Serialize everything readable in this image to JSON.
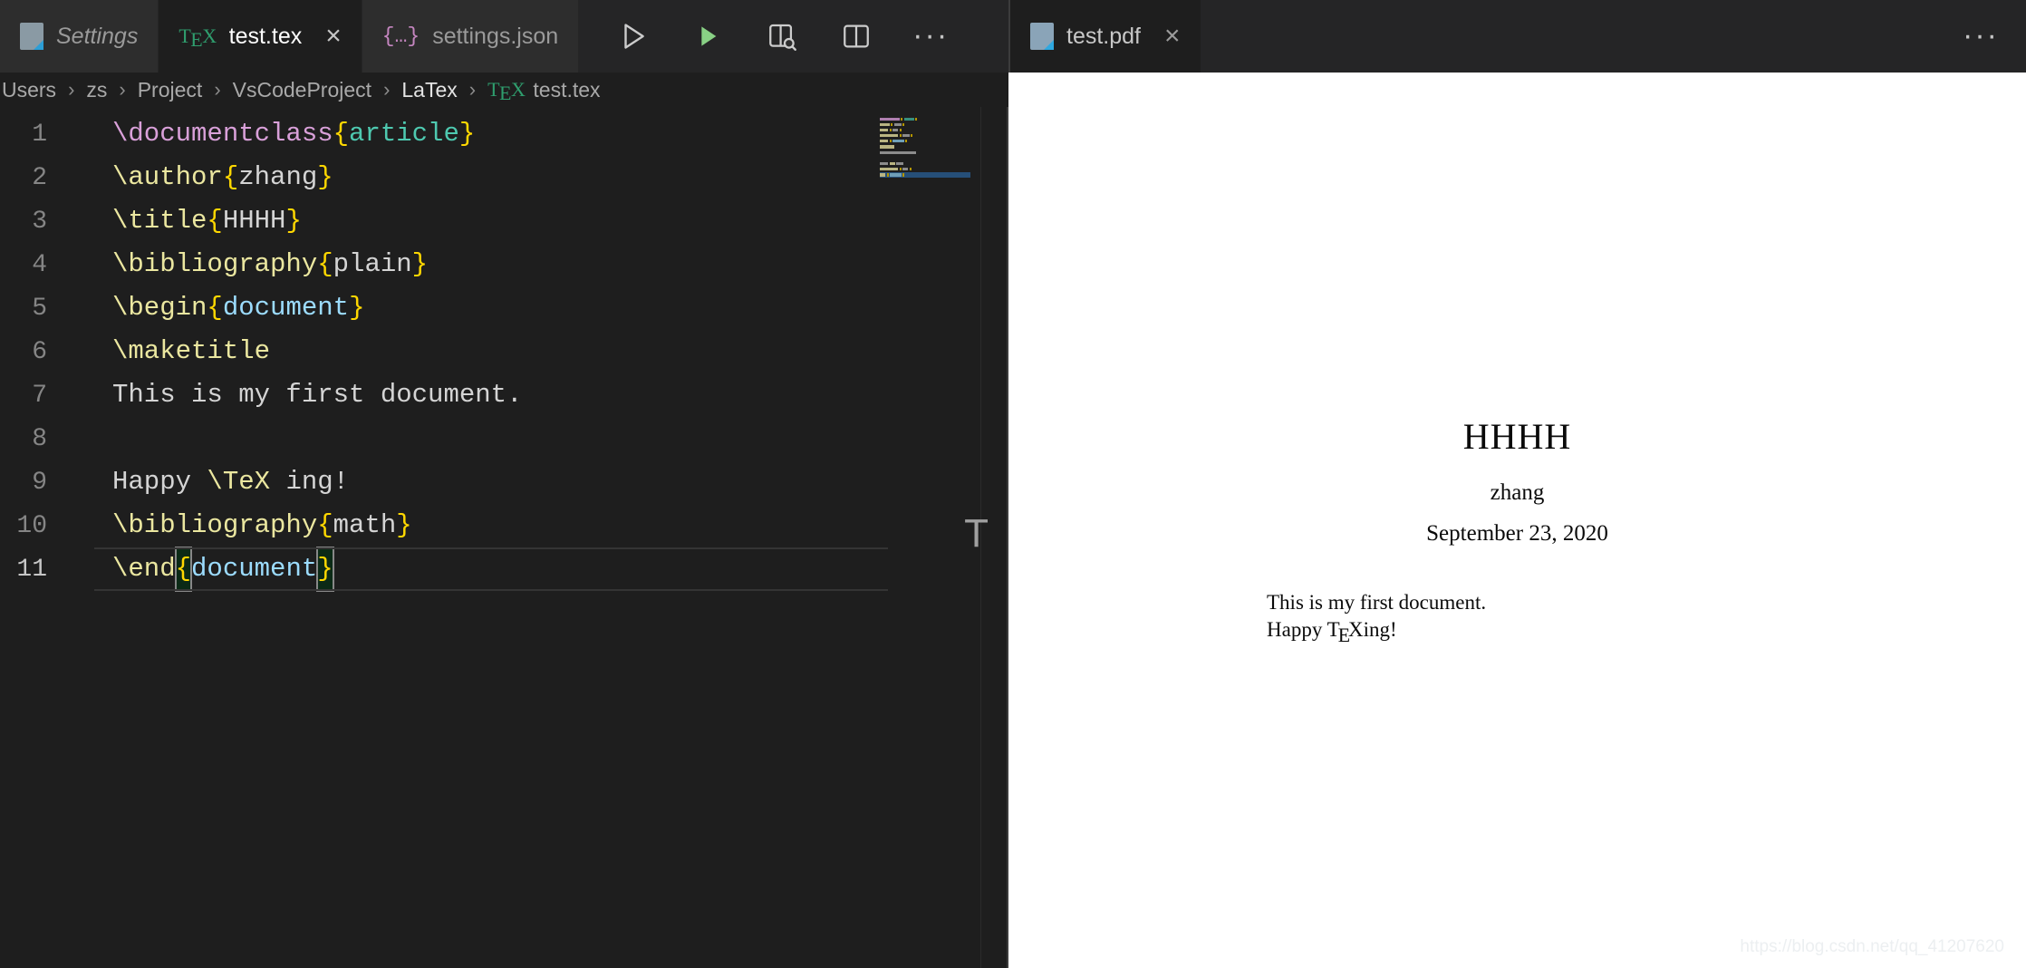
{
  "window": {
    "app": "Visual Studio Code",
    "theme_bg": "#1e1e1e",
    "tabbar_bg": "#252526",
    "accent_green": "#89d185"
  },
  "left_editor_group": {
    "tabs": [
      {
        "label": "Settings",
        "icon": "settings-document-icon",
        "active": false,
        "italic": true,
        "closable": false
      },
      {
        "label": "test.tex",
        "icon": "tex-file-icon",
        "active": true,
        "italic": false,
        "closable": true,
        "close_label": "×"
      },
      {
        "label": "settings.json",
        "icon": "json-file-icon",
        "active": false,
        "italic": false,
        "closable": false
      }
    ],
    "actions": [
      {
        "name": "build-latex-project-button",
        "icon": "play-outline-icon",
        "label": "Build LaTeX project"
      },
      {
        "name": "run-button",
        "icon": "play-filled-green-icon",
        "label": "Run"
      },
      {
        "name": "view-latex-pdf-button",
        "icon": "split-preview-search-icon",
        "label": "View LaTeX PDF file"
      },
      {
        "name": "split-editor-button",
        "icon": "split-editor-icon",
        "label": "Split Editor"
      },
      {
        "name": "more-actions-button",
        "icon": "ellipsis-icon",
        "label": "···"
      }
    ],
    "breadcrumb": {
      "separator": "›",
      "items": [
        {
          "label": "Users",
          "strong": false
        },
        {
          "label": "zs",
          "strong": false
        },
        {
          "label": "Project",
          "strong": false
        },
        {
          "label": "VsCodeProject",
          "strong": false
        },
        {
          "label": "LaTex",
          "strong": true
        },
        {
          "label": "test.tex",
          "strong": false,
          "icon": "tex-file-icon"
        }
      ]
    }
  },
  "right_editor_group": {
    "tabs": [
      {
        "label": "test.pdf",
        "icon": "pdf-document-icon",
        "active": true,
        "closable": true,
        "close_label": "×"
      }
    ],
    "actions": [
      {
        "name": "more-actions-button",
        "icon": "ellipsis-icon",
        "label": "···"
      }
    ]
  },
  "code": {
    "language": "latex",
    "active_line": 11,
    "lines": [
      {
        "n": "1",
        "tokens": [
          {
            "t": "\\documentclass",
            "c": "tok-cmd2"
          },
          {
            "t": "{",
            "c": "tok-brace"
          },
          {
            "t": "article",
            "c": "tok-green"
          },
          {
            "t": "}",
            "c": "tok-brace"
          }
        ]
      },
      {
        "n": "2",
        "tokens": [
          {
            "t": "\\author",
            "c": "tok-cmd"
          },
          {
            "t": "{",
            "c": "tok-brace"
          },
          {
            "t": "zhang",
            "c": "tok-arg"
          },
          {
            "t": "}",
            "c": "tok-brace"
          }
        ]
      },
      {
        "n": "3",
        "tokens": [
          {
            "t": "\\title",
            "c": "tok-cmd"
          },
          {
            "t": "{",
            "c": "tok-brace"
          },
          {
            "t": "HHHH",
            "c": "tok-arg"
          },
          {
            "t": "}",
            "c": "tok-brace"
          }
        ]
      },
      {
        "n": "4",
        "tokens": [
          {
            "t": "\\bibliography",
            "c": "tok-cmd"
          },
          {
            "t": "{",
            "c": "tok-brace"
          },
          {
            "t": "plain",
            "c": "tok-arg"
          },
          {
            "t": "}",
            "c": "tok-brace"
          }
        ]
      },
      {
        "n": "5",
        "tokens": [
          {
            "t": "\\begin",
            "c": "tok-cmd"
          },
          {
            "t": "{",
            "c": "tok-brace"
          },
          {
            "t": "document",
            "c": "tok-blue"
          },
          {
            "t": "}",
            "c": "tok-brace"
          }
        ]
      },
      {
        "n": "6",
        "tokens": [
          {
            "t": "\\maketitle",
            "c": "tok-cmd"
          }
        ]
      },
      {
        "n": "7",
        "tokens": [
          {
            "t": "This is my first document.",
            "c": "tok-plain"
          }
        ]
      },
      {
        "n": "8",
        "tokens": []
      },
      {
        "n": "9",
        "tokens": [
          {
            "t": "Happy ",
            "c": "tok-plain"
          },
          {
            "t": "\\TeX",
            "c": "tok-cmd"
          },
          {
            "t": " ing!",
            "c": "tok-plain"
          }
        ]
      },
      {
        "n": "10",
        "tokens": [
          {
            "t": "\\bibliography",
            "c": "tok-cmd"
          },
          {
            "t": "{",
            "c": "tok-brace"
          },
          {
            "t": "math",
            "c": "tok-arg"
          },
          {
            "t": "}",
            "c": "tok-brace"
          }
        ]
      },
      {
        "n": "11",
        "tokens": [
          {
            "t": "\\end",
            "c": "tok-cmd"
          },
          {
            "t": "{",
            "c": "tok-brace",
            "hl": true
          },
          {
            "t": "document",
            "c": "tok-blue"
          },
          {
            "t": "}",
            "c": "tok-brace",
            "hl": true
          }
        ]
      }
    ]
  },
  "pdf": {
    "title": "HHHH",
    "author": "zhang",
    "date": "September 23, 2020",
    "body_line_1": "This is my first document.",
    "body_line_2_prefix": "Happy T",
    "body_line_2_e": "E",
    "body_line_2_suffix": "Xing!"
  },
  "divider": {
    "handle_glyph": "T"
  },
  "watermark": {
    "text": "https://blog.csdn.net/qq_41207620"
  }
}
